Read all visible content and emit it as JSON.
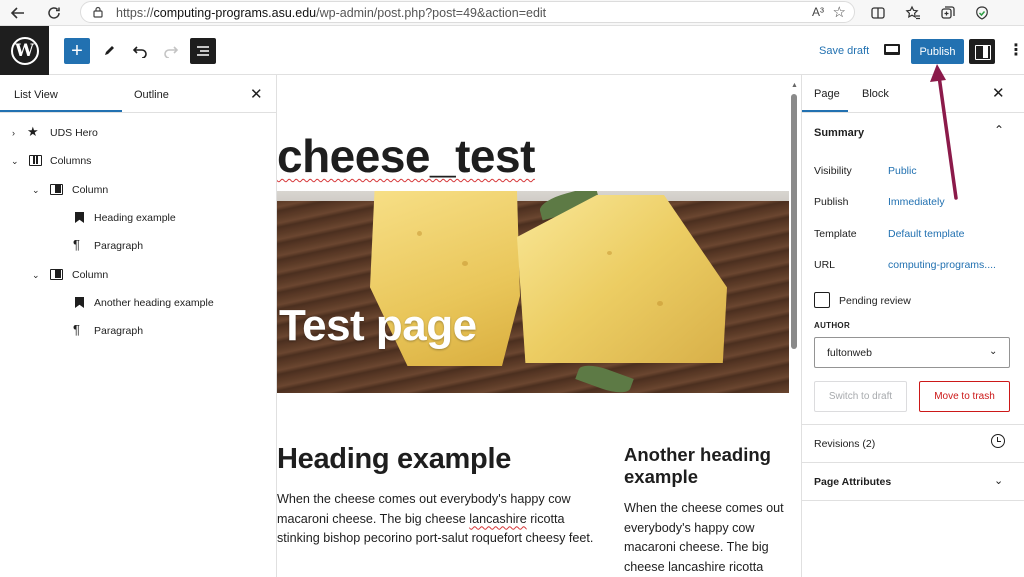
{
  "browser": {
    "url_prefix": "https://",
    "url_domain": "computing-programs.asu.edu",
    "url_path": "/wp-admin/post.php?post=49&action=edit",
    "read_aloud_icon": "A³",
    "icons": [
      "back-arrow-icon",
      "refresh-icon",
      "lock-icon",
      "star-icon",
      "split-screen-icon",
      "favorites-icon",
      "collections-icon",
      "extensions-icon"
    ]
  },
  "toolbar": {
    "save_draft": "Save draft",
    "publish": "Publish"
  },
  "list_view": {
    "tab_list": "List View",
    "tab_outline": "Outline",
    "items": [
      {
        "label": "UDS Hero"
      },
      {
        "label": "Columns"
      },
      {
        "label": "Column"
      },
      {
        "label": "Heading example"
      },
      {
        "label": "Paragraph"
      },
      {
        "label": "Column"
      },
      {
        "label": "Another heading example"
      },
      {
        "label": "Paragraph"
      }
    ]
  },
  "canvas": {
    "post_title": "cheese_test",
    "hero_title": "Test page",
    "left_heading": "Heading example",
    "left_paragraph_before": "When the cheese comes out everybody's happy cow macaroni cheese. The big cheese ",
    "left_paragraph_spell": "lancashire",
    "left_paragraph_after": " ricotta stinking bishop pecorino port-salut roquefort cheesy feet.",
    "right_heading": "Another heading example",
    "right_paragraph": "When the cheese comes out everybody's happy cow macaroni cheese. The big cheese lancashire ricotta"
  },
  "sidebar": {
    "tab_page": "Page",
    "tab_block": "Block",
    "summary_title": "Summary",
    "rows": [
      {
        "label": "Visibility",
        "value": "Public"
      },
      {
        "label": "Publish",
        "value": "Immediately"
      },
      {
        "label": "Template",
        "value": "Default template"
      },
      {
        "label": "URL",
        "value": "computing-programs...."
      }
    ],
    "pending_review": "Pending review",
    "author_label": "AUTHOR",
    "author_value": "fultonweb",
    "switch_to_draft": "Switch to draft",
    "move_to_trash": "Move to trash",
    "revisions": "Revisions (2)",
    "page_attributes": "Page Attributes"
  },
  "colors": {
    "accent": "#2271b1",
    "danger": "#cc1818",
    "annotation_arrow": "#8b1a4a",
    "dark": "#1e1e1e"
  }
}
